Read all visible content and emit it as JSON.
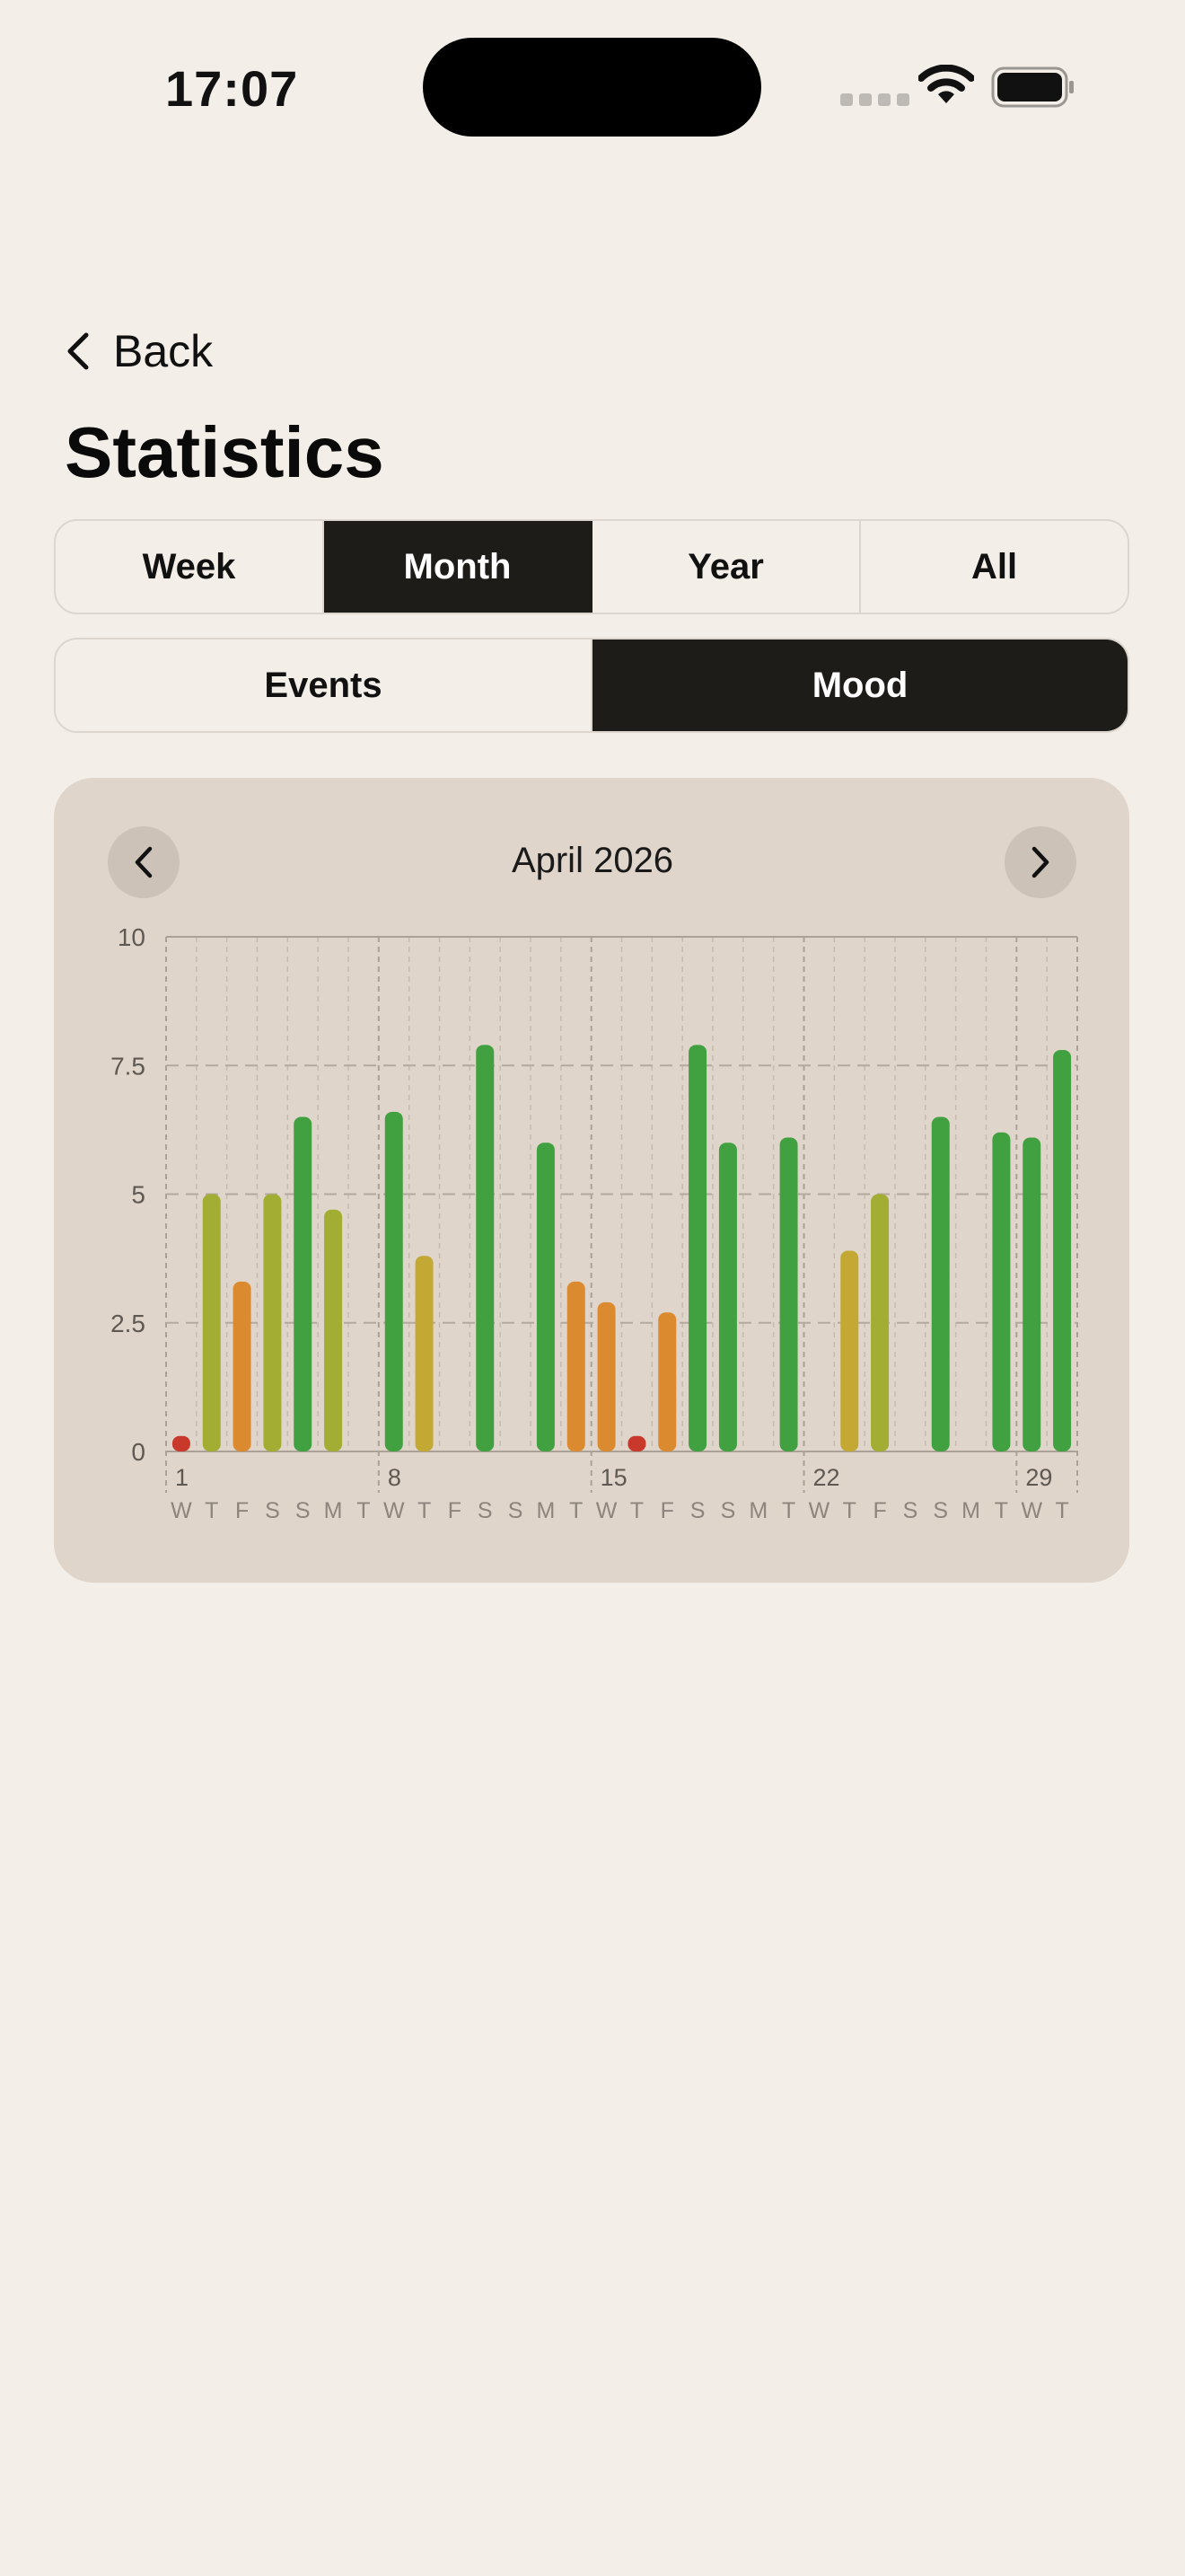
{
  "status_bar": {
    "time": "17:07"
  },
  "header": {
    "back_label": "Back",
    "title": "Statistics"
  },
  "period_tabs": [
    {
      "label": "Week",
      "active": false
    },
    {
      "label": "Month",
      "active": true
    },
    {
      "label": "Year",
      "active": false
    },
    {
      "label": "All",
      "active": false
    }
  ],
  "view_tabs": [
    {
      "label": "Events",
      "active": false
    },
    {
      "label": "Mood",
      "active": true
    }
  ],
  "calendar_nav": {
    "month_label": "April 2026",
    "prev_icon": "chevron-left-icon",
    "next_icon": "chevron-right-icon"
  },
  "colors": {
    "background": "#f3eee8",
    "card": "#e0d5ca",
    "active_tab": "#1d1c19",
    "mood_red": "#c8382b",
    "mood_orange": "#dc8a30",
    "mood_yellow": "#c3a833",
    "mood_olive": "#a2ad33",
    "mood_green": "#41a040"
  },
  "chart_data": {
    "type": "bar",
    "ylim": [
      0,
      10
    ],
    "y_ticks": [
      "0",
      "2.5",
      "5",
      "7.5",
      "10"
    ],
    "week_start_labels": [
      {
        "day": 1,
        "label": "1"
      },
      {
        "day": 8,
        "label": "8"
      },
      {
        "day": 15,
        "label": "15"
      },
      {
        "day": 22,
        "label": "22"
      },
      {
        "day": 29,
        "label": "29"
      }
    ],
    "days": [
      1,
      2,
      3,
      4,
      5,
      6,
      7,
      8,
      9,
      10,
      11,
      12,
      13,
      14,
      15,
      16,
      17,
      18,
      19,
      20,
      21,
      22,
      23,
      24,
      25,
      26,
      27,
      28,
      29,
      30
    ],
    "weekday_letters": [
      "W",
      "T",
      "F",
      "S",
      "S",
      "M",
      "T",
      "W",
      "T",
      "F",
      "S",
      "S",
      "M",
      "T",
      "W",
      "T",
      "F",
      "S",
      "S",
      "M",
      "T",
      "W",
      "T",
      "F",
      "S",
      "S",
      "M",
      "T",
      "W",
      "T"
    ],
    "values": [
      0.3,
      5.0,
      3.3,
      5.0,
      6.5,
      4.7,
      null,
      6.6,
      3.8,
      null,
      7.9,
      null,
      6.0,
      3.3,
      2.9,
      0.3,
      2.7,
      7.9,
      6.0,
      null,
      6.1,
      null,
      3.9,
      5.0,
      null,
      6.5,
      null,
      6.2,
      6.1,
      7.8
    ]
  }
}
